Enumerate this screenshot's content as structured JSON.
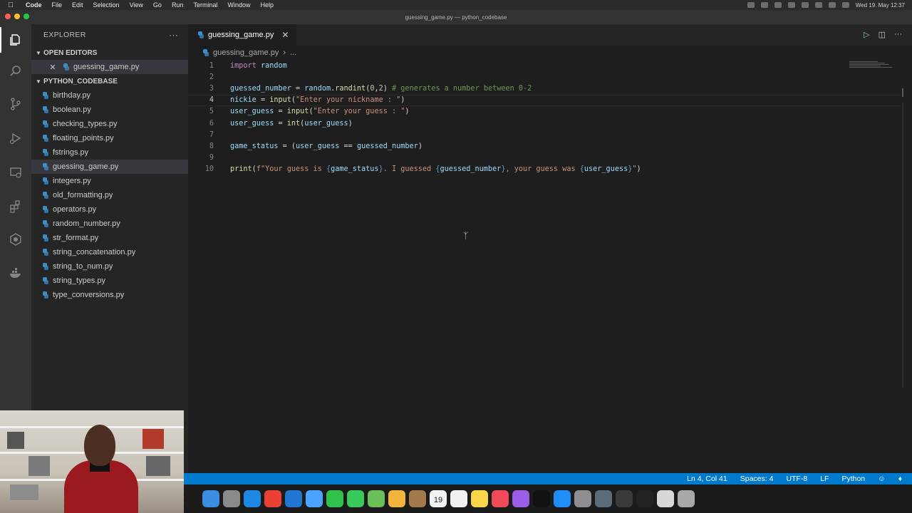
{
  "menubar": {
    "app": "Code",
    "items": [
      "File",
      "Edit",
      "Selection",
      "View",
      "Go",
      "Run",
      "Terminal",
      "Window",
      "Help"
    ],
    "clock": "Wed 19. May 12:37"
  },
  "window": {
    "title": "guessing_game.py — python_codebase"
  },
  "sidebar": {
    "header": "EXPLORER",
    "open_editors_label": "OPEN EDITORS",
    "open_editors": [
      {
        "name": "guessing_game.py"
      }
    ],
    "folder_label": "PYTHON_CODEBASE",
    "files": [
      "birthday.py",
      "boolean.py",
      "checking_types.py",
      "floating_points.py",
      "fstrings.py",
      "guessing_game.py",
      "integers.py",
      "old_formatting.py",
      "operators.py",
      "random_number.py",
      "str_format.py",
      "string_concatenation.py",
      "string_to_num.py",
      "string_types.py",
      "type_conversions.py"
    ],
    "selected_file": "guessing_game.py"
  },
  "tabs": [
    {
      "label": "guessing_game.py",
      "active": true
    }
  ],
  "breadcrumb": {
    "file": "guessing_game.py",
    "more": "..."
  },
  "editor": {
    "current_line": 4,
    "lines": [
      {
        "n": "1",
        "text": "import random"
      },
      {
        "n": "2",
        "text": ""
      },
      {
        "n": "3",
        "text": "guessed_number = random.randint(0,2) # generates a number between 0-2"
      },
      {
        "n": "4",
        "text": "nickie = input(\"Enter your nickname : \")"
      },
      {
        "n": "5",
        "text": "user_guess = input(\"Enter your guess : \")"
      },
      {
        "n": "6",
        "text": "user_guess = int(user_guess)"
      },
      {
        "n": "7",
        "text": ""
      },
      {
        "n": "8",
        "text": "game_status = (user_guess == guessed_number)"
      },
      {
        "n": "9",
        "text": ""
      },
      {
        "n": "10",
        "text": "print(f\"Your guess is {game_status}. I guessed {guessed_number}, your guess was {user_guess}\")"
      }
    ]
  },
  "statusbar": {
    "position": "Ln 4, Col 41",
    "indent": "Spaces: 4",
    "encoding": "UTF-8",
    "eol": "LF",
    "language": "Python"
  },
  "dock": {
    "calendar_day": "19"
  },
  "colors": {
    "accent": "#007acc",
    "editor_bg": "#1e1e1e",
    "sidebar_bg": "#252526",
    "activity_bg": "#333333"
  }
}
